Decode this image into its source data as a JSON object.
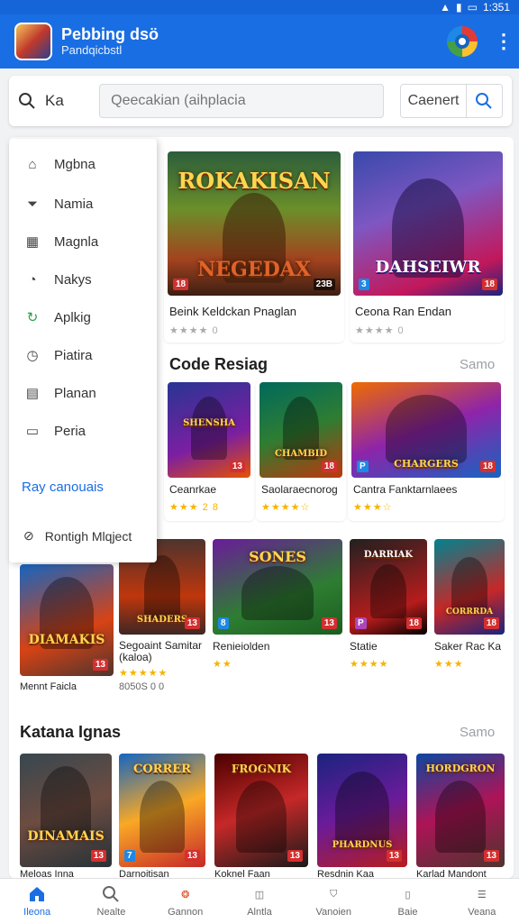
{
  "status": {
    "time": "1:351"
  },
  "appbar": {
    "title": "Pebbing dsö",
    "subtitle": "Pandqicbstl",
    "avatar_icon": "game-avatar-icon",
    "logo_icon": "app-logo-icon",
    "menu_icon": "kebab-icon"
  },
  "search": {
    "prefix": "Ka",
    "placeholder": "Qeecakian (aihplacia",
    "cancel_label": "Caenert"
  },
  "drawer": {
    "items": [
      {
        "label": "Mgbna",
        "icon": "home-outline-icon"
      },
      {
        "label": "Namia",
        "icon": "filter-icon"
      },
      {
        "label": "Magnla",
        "icon": "grid-icon"
      },
      {
        "label": "Nakys",
        "icon": "badge-icon"
      },
      {
        "label": "Aplkig",
        "icon": "refresh-icon"
      },
      {
        "label": "Piatira",
        "icon": "clock-icon"
      },
      {
        "label": "Planan",
        "icon": "calendar-icon"
      },
      {
        "label": "Peria",
        "icon": "document-icon"
      }
    ],
    "link": "Ray canouais",
    "footer": "Rontigh Mlqject"
  },
  "featured": [
    {
      "banner_top": "ROKAKISAN",
      "banner_bottom": "NEGEDAX",
      "badge": "23B",
      "title": "Beink Keldckan Pnaglan",
      "stars": "★★★★ 0"
    },
    {
      "banner_top": "",
      "banner_bottom": "DAHSEIWR",
      "badge": "",
      "title": "Ceona Ran Endan",
      "stars": "★★★★ 0"
    }
  ],
  "section1": {
    "title": "Code Resiag",
    "more": "Samo"
  },
  "row1": [
    {
      "banner": "SHENSHA",
      "title": "Ceanrkae",
      "stars": "★★★ 2 8",
      "badge": "13"
    },
    {
      "banner": "CHAMBID",
      "title": "Saolaraecnorog",
      "stars": "★★★★☆",
      "badge": "18"
    },
    {
      "banner": "CHARGERS",
      "title": "Cantra Fanktarnlaees",
      "stars": "★★★☆",
      "badge": "18"
    }
  ],
  "row2": [
    {
      "banner": "DIAMAKIS",
      "title": "Mennt Faicla",
      "stars": "",
      "badge": "13",
      "meta": ""
    },
    {
      "banner": "SHADERS",
      "title": "Segoaint Samitar (kaloa)",
      "stars": "★★★★★",
      "badge": "13",
      "meta": "8050S 0 0"
    },
    {
      "banner": "SONES",
      "title": "Renieiolden",
      "stars": "★★",
      "badge": "13",
      "meta": ""
    },
    {
      "banner": "DARRIAK",
      "title": "Statie",
      "stars": "★★★★",
      "badge": "18",
      "meta": ""
    },
    {
      "banner": "CORRRDA",
      "title": "Saker Rac Ka",
      "stars": "★★★",
      "badge": "18",
      "meta": ""
    }
  ],
  "section2": {
    "title": "Katana Ignas",
    "more": "Samo"
  },
  "row3": [
    {
      "banner": "DINAMAIS",
      "badge": "13"
    },
    {
      "banner": "CORRER",
      "badge": "13"
    },
    {
      "banner": "FROGNIK",
      "badge": "13"
    },
    {
      "banner": "PHARDNUS",
      "badge": "13"
    },
    {
      "banner": "HORDGRON",
      "badge": "13"
    }
  ],
  "row3_titles": [
    "Meloas Inna",
    "Darnoitisan",
    "Koknel Faan",
    "Resdnin Kaa",
    "Karlad Mandont"
  ],
  "bottomnav": [
    {
      "label": "Ileona",
      "icon": "home-icon",
      "active": true
    },
    {
      "label": "Nealte",
      "icon": "search-icon",
      "active": false
    },
    {
      "label": "Gannon",
      "icon": "games-icon",
      "active": false
    },
    {
      "label": "Alntla",
      "icon": "apps-icon",
      "active": false
    },
    {
      "label": "Vanoien",
      "icon": "shield-icon",
      "active": false
    },
    {
      "label": "Baie",
      "icon": "library-icon",
      "active": false
    },
    {
      "label": "Veana",
      "icon": "menu-icon",
      "active": false
    }
  ],
  "colors": {
    "primary": "#1a6ee3",
    "star": "#f4b400",
    "badge": "#d32f2f"
  }
}
